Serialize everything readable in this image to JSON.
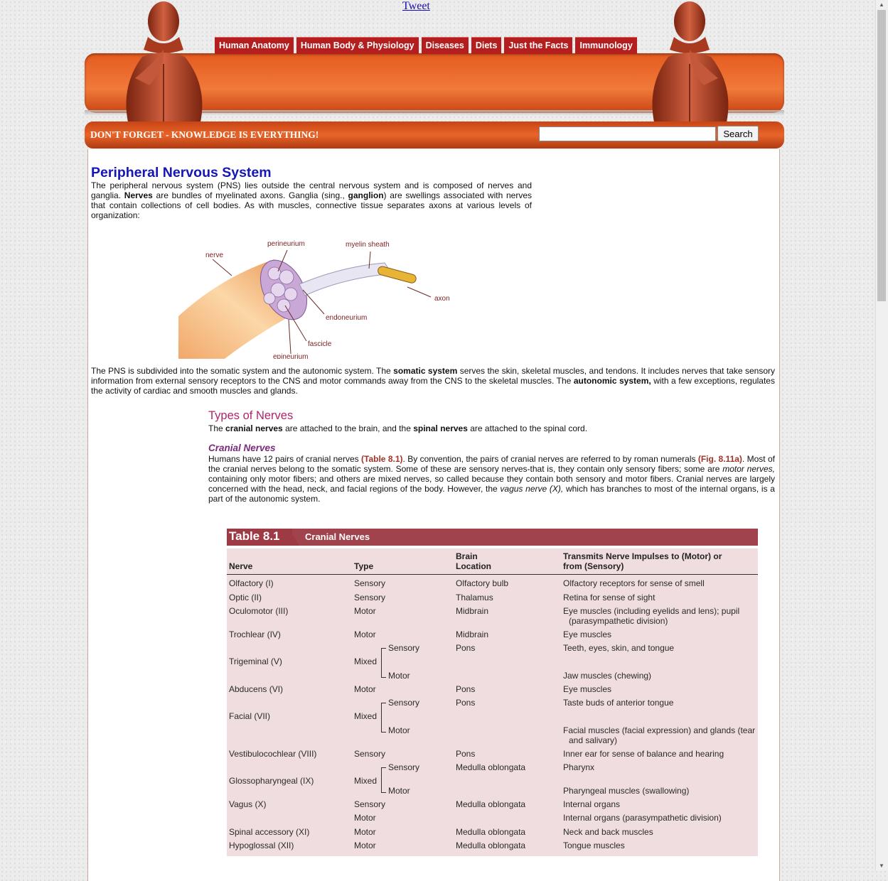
{
  "tweet": "Tweet",
  "nav": [
    "Human Anatomy",
    "Human Body & Physiology",
    "Diseases",
    "Diets",
    "Just the Facts",
    "Immunology"
  ],
  "slogan": "DON'T FORGET - KNOWLEDGE IS EVERYTHING!",
  "search": {
    "value": "",
    "button": "Search"
  },
  "article": {
    "title": "Peripheral Nervous System",
    "intro_parts": [
      "The peripheral nervous system (PNS) lies outside the central nervous system and is composed of nerves and ganglia. ",
      "Nerves",
      " are bundles of myelinated axons. Ganglia (sing., ",
      "ganglion",
      ") are swellings associated with nerves that contain collections of cell bodies. As with muscles, connective tissue separates axons at various levels of organization:"
    ],
    "figure_labels": {
      "nerve": "nerve",
      "perineurium": "perineurium",
      "myelin": "myelin sheath",
      "axon": "axon",
      "endoneurium": "endoneurium",
      "fascicle": "fascicle",
      "epineurium": "epineurium"
    },
    "pns_parts": [
      "The PNS is subdivided into the somatic system and the autonomic system. The ",
      "somatic system",
      " serves the skin, skeletal muscles, and tendons. It includes nerves that take sensory information from external sensory receptors to the CNS and motor commands away from the CNS to the skeletal muscles. The ",
      "autonomic system,",
      " with a few exceptions, regulates the activity of cardiac and smooth muscles and glands."
    ],
    "types_title": "Types of Nerves",
    "types_parts": [
      "The ",
      "cranial nerves",
      " are attached to the brain, and the ",
      "spinal nerves",
      " are attached to the spinal cord."
    ],
    "cranial_title": "Cranial Nerves",
    "cranial_parts": [
      "Humans have 12 pairs of cranial nerves ",
      "(Table 8.1)",
      ". By convention, the pairs of cranial nerves are referred to by roman numerals ",
      "(Fig. 8.11a)",
      ". Most of the cranial nerves belong to the somatic system. Some of these are sensory nerves-that is, they contain only sensory fibers; some are ",
      "motor nerves,",
      " containing only motor fibers; and others are mixed nerves, so called because they contain both sensory and motor fibers. Cranial nerves are largely concerned with the head, neck, and facial regions of the body. However, the ",
      "vagus nerve (X),",
      " which has branches to most of the internal organs, is a part of the autonomic system."
    ]
  },
  "table": {
    "number": "Table 8.1",
    "name": "Cranial Nerves",
    "headers": {
      "nerve": "Nerve",
      "type": "Type",
      "brain1": "Brain",
      "brain2": "Location",
      "trans1": "Transmits Nerve Impulses to (Motor) or",
      "trans2": "from (Sensory)"
    },
    "rows": [
      {
        "nerve": "Olfactory (I)",
        "type": "Sensory",
        "sub": "",
        "loc": "Olfactory bulb",
        "trans": "Olfactory receptors for sense of smell"
      },
      {
        "nerve": "Optic (II)",
        "type": "Sensory",
        "sub": "",
        "loc": "Thalamus",
        "trans": "Retina for sense of sight"
      },
      {
        "nerve": "Oculomotor (III)",
        "type": "Motor",
        "sub": "",
        "loc": "Midbrain",
        "trans": "Eye muscles (including eyelids and lens); pupil",
        "trans2": "(parasympathetic division)"
      },
      {
        "nerve": "Trochlear (IV)",
        "type": "Motor",
        "sub": "",
        "loc": "Midbrain",
        "trans": "Eye muscles"
      },
      {
        "nerve": "",
        "type": "",
        "sub": "Sensory",
        "loc": "Pons",
        "trans": "Teeth, eyes, skin, and tongue"
      },
      {
        "nerve": "Trigeminal (V)",
        "type": "Mixed",
        "sub": "",
        "loc": "",
        "trans": ""
      },
      {
        "nerve": "",
        "type": "",
        "sub": "Motor",
        "loc": "",
        "trans": "Jaw muscles (chewing)"
      },
      {
        "nerve": "Abducens (VI)",
        "type": "Motor",
        "sub": "",
        "loc": "Pons",
        "trans": "Eye muscles"
      },
      {
        "nerve": "",
        "type": "",
        "sub": "Sensory",
        "loc": "Pons",
        "trans": "Taste buds of anterior tongue"
      },
      {
        "nerve": "Facial (VII)",
        "type": "Mixed",
        "sub": "",
        "loc": "",
        "trans": ""
      },
      {
        "nerve": "",
        "type": "",
        "sub": "Motor",
        "loc": "",
        "trans": "Facial muscles (facial expression) and glands (tear",
        "trans2": "and salivary)"
      },
      {
        "nerve": "Vestibulocochlear (VIII)",
        "type": "Sensory",
        "sub": "",
        "loc": "Pons",
        "trans": "Inner ear for sense of balance and hearing"
      },
      {
        "nerve": "",
        "type": "",
        "sub": "Sensory",
        "loc": "Medulla oblongata",
        "trans": "Pharynx"
      },
      {
        "nerve": "Glossopharyngeal (IX)",
        "type": "Mixed",
        "sub": "",
        "loc": "",
        "trans": ""
      },
      {
        "nerve": "",
        "type": "",
        "sub": "Motor",
        "loc": "",
        "trans": "Pharyngeal muscles (swallowing)"
      },
      {
        "nerve": "Vagus (X)",
        "type": "Sensory",
        "sub": "",
        "loc": "Medulla oblongata",
        "trans": "Internal organs"
      },
      {
        "nerve": "",
        "type": "Motor",
        "sub": "",
        "loc": "",
        "trans": "Internal organs (parasympathetic division)"
      },
      {
        "nerve": "Spinal accessory (XI)",
        "type": "Motor",
        "sub": "",
        "loc": "Medulla oblongata",
        "trans": "Neck and back muscles"
      },
      {
        "nerve": "Hypoglossal (XII)",
        "type": "Motor",
        "sub": "",
        "loc": "Medulla oblongata",
        "trans": "Tongue muscles"
      }
    ]
  },
  "colors": {
    "nav": "#b51e1e",
    "banner": "#e8652a",
    "title": "#1515b8",
    "section": "#b0246a",
    "table_bg": "#efdde0",
    "table_head": "#9e3a44"
  }
}
